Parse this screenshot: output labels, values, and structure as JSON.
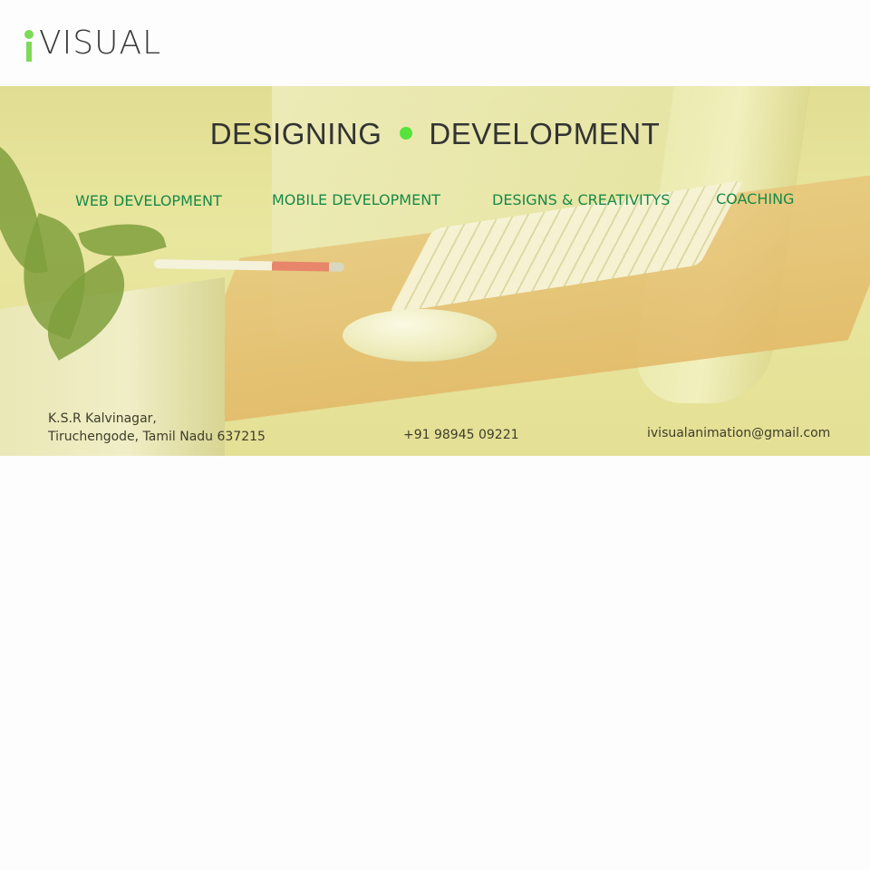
{
  "logo": {
    "text": "VISUAL"
  },
  "hero": {
    "title_left": "DESIGNING",
    "title_right": "DEVELOPMENT",
    "accent_color": "#55e33c"
  },
  "nav": {
    "items": [
      {
        "label": "WEB DEVELOPMENT"
      },
      {
        "label": "MOBILE DEVELOPMENT"
      },
      {
        "label": "DESIGNS & CREATIVITYS"
      },
      {
        "label": "COACHING"
      }
    ],
    "color": "#178a48"
  },
  "contact": {
    "address_line1": "K.S.R Kalvinagar,",
    "address_line2": "Tiruchengode, Tamil Nadu 637215",
    "phone": "+91 98945 09221",
    "email": "ivisualanimation@gmail.com"
  }
}
